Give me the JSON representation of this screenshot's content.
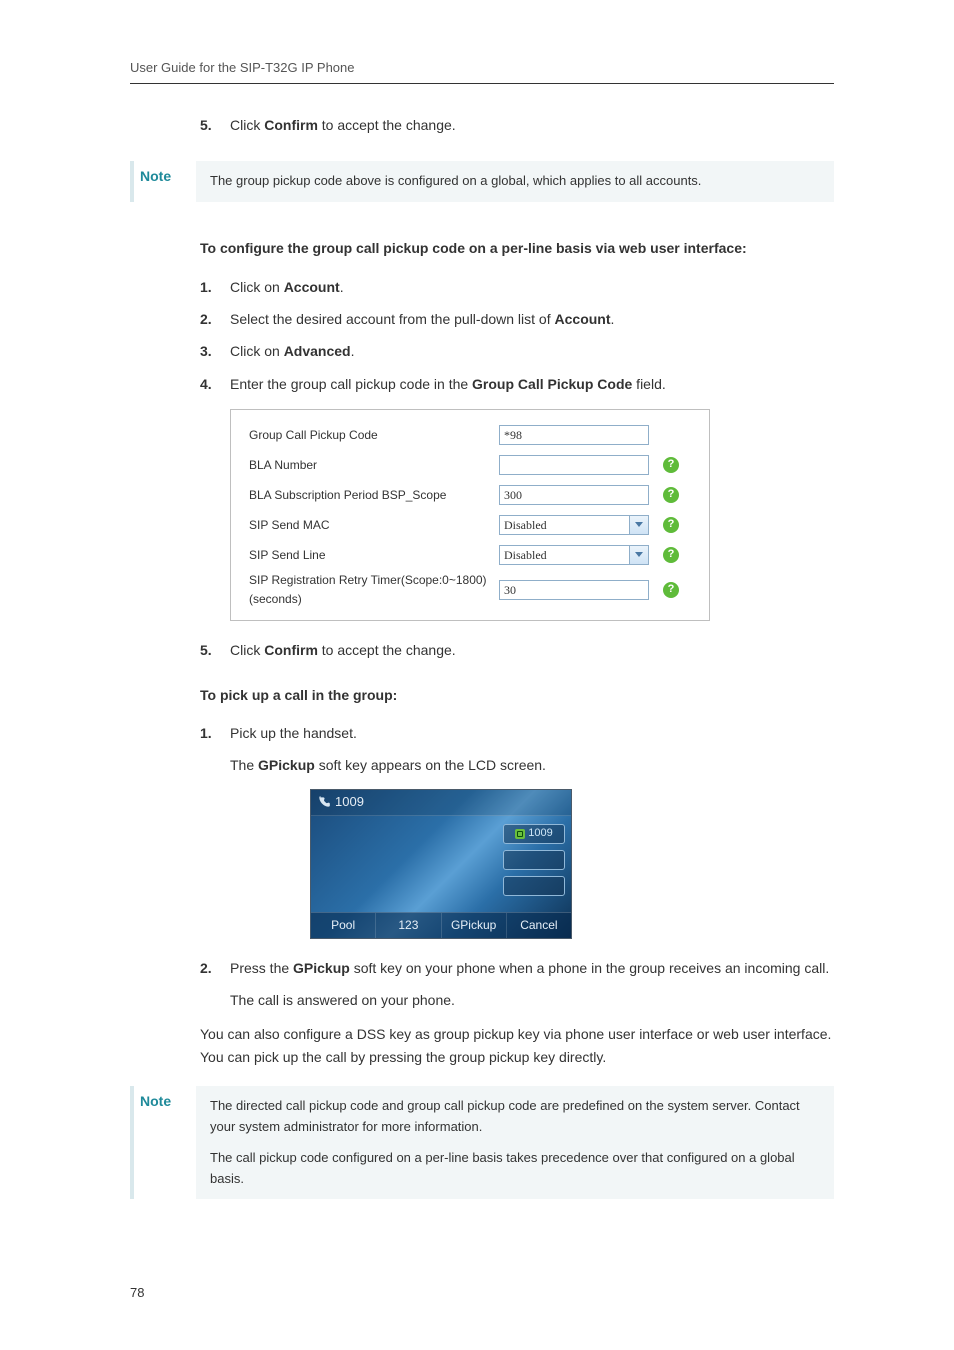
{
  "header": {
    "title": "User Guide for the SIP-T32G IP Phone"
  },
  "intro_step": {
    "num": "5.",
    "pre": "Click ",
    "bold": "Confirm",
    "post": " to accept the change."
  },
  "note1": {
    "label": "Note",
    "text": "The group pickup code above is configured on a global, which applies to all accounts."
  },
  "section1": {
    "heading": "To configure the group call pickup code on a per-line basis via web user interface:",
    "steps": [
      {
        "num": "1.",
        "pre": "Click on ",
        "bold": "Account",
        "post": "."
      },
      {
        "num": "2.",
        "pre": "Select the desired account from the pull-down list of ",
        "bold": "Account",
        "post": "."
      },
      {
        "num": "3.",
        "pre": "Click on ",
        "bold": "Advanced",
        "post": "."
      },
      {
        "num": "4.",
        "pre": "Enter the group call pickup code in the ",
        "bold": "Group Call Pickup Code",
        "post": " field."
      }
    ]
  },
  "config": {
    "rows": [
      {
        "label": "Group Call Pickup Code",
        "type": "input",
        "value": "*98",
        "help": false
      },
      {
        "label": "BLA Number",
        "type": "input",
        "value": "",
        "help": true
      },
      {
        "label": "BLA Subscription Period BSP_Scope",
        "type": "input",
        "value": "300",
        "help": true
      },
      {
        "label": "SIP Send MAC",
        "type": "select",
        "value": "Disabled",
        "help": true
      },
      {
        "label": "SIP Send Line",
        "type": "select",
        "value": "Disabled",
        "help": true
      },
      {
        "label": "SIP Registration Retry Timer(Scope:0~1800)(seconds)",
        "type": "input",
        "value": "30",
        "help": true
      }
    ]
  },
  "after_config_step": {
    "num": "5.",
    "pre": "Click ",
    "bold": "Confirm",
    "post": " to accept the change."
  },
  "section2": {
    "heading": "To pick up a call in the group:",
    "step1": {
      "num": "1.",
      "text": "Pick up the handset."
    },
    "sub1_pre": "The ",
    "sub1_bold": "GPickup",
    "sub1_post": " soft key appears on the LCD screen."
  },
  "lcd": {
    "top_number": "1009",
    "line_slot": "1009",
    "softkeys": [
      "Pool",
      "123",
      "GPickup",
      "Cancel"
    ]
  },
  "section2b": {
    "step2": {
      "num": "2.",
      "pre": "Press the ",
      "bold": "GPickup",
      "post": " soft key on your phone when a phone in the group receives an incoming call."
    },
    "sub2": "The call is answered on your phone.",
    "para": "You can also configure a DSS key as group pickup key via phone user interface or web user interface. You can pick up the call by pressing the group pickup key directly."
  },
  "note2": {
    "label": "Note",
    "p1": "The directed call pickup code and group call pickup code are predefined on the system server. Contact your system administrator for more information.",
    "p2": "The call pickup code configured on a per-line basis takes precedence over that configured on a global basis."
  },
  "page_number": "78",
  "help_glyph": "?"
}
